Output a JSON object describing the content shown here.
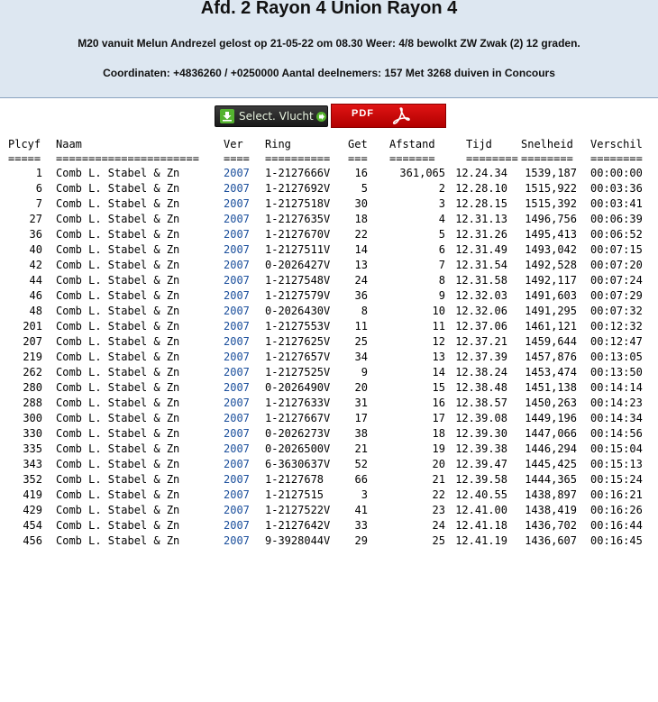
{
  "header": {
    "title": "Afd. 2 Rayon 4 Union Rayon 4",
    "subtitle": "M20 vanuit Melun Andrezel gelost op 21-05-22 om 08.30 Weer: 4/8 bewolkt ZW Zwak (2) 12 graden.",
    "coords": "Coordinaten: +4836260 / +0250000 Aantal deelnemers: 157 Met 3268 duiven in Concours"
  },
  "toolbar": {
    "select_label": "Select. Vlucht",
    "pdf_label": "PDF"
  },
  "colors": {
    "header_bg": "#dde7f1",
    "year_link": "#1b4f9c",
    "pdf_red": "#d40a0a",
    "select_bg": "#2a2a2a"
  },
  "table": {
    "columns": {
      "plcyf": "Plcyf",
      "naam": "Naam",
      "ver": "Ver",
      "ring": "Ring",
      "get": "Get",
      "afstand": "Afstand",
      "tijd": "Tijd",
      "snelheid": "Snelheid",
      "verschil": "Verschil"
    },
    "separators": {
      "plcyf": "=====",
      "naam": "======================",
      "ver": "====",
      "ring": "==========",
      "get": "===",
      "afstand": "=======",
      "tijd": "========",
      "snelheid": "========",
      "verschil": "========"
    },
    "rows": [
      {
        "plcyf": "1",
        "naam": "Comb L. Stabel & Zn",
        "ver": "2007",
        "ring": "1-2127666V",
        "get": "16",
        "afstand": "361,065",
        "tijd": "12.24.34",
        "snelheid": "1539,187",
        "verschil": "00:00:00"
      },
      {
        "plcyf": "6",
        "naam": "Comb L. Stabel & Zn",
        "ver": "2007",
        "ring": "1-2127692V",
        "get": "5",
        "afstand": "2",
        "tijd": "12.28.10",
        "snelheid": "1515,922",
        "verschil": "00:03:36"
      },
      {
        "plcyf": "7",
        "naam": "Comb L. Stabel & Zn",
        "ver": "2007",
        "ring": "1-2127518V",
        "get": "30",
        "afstand": "3",
        "tijd": "12.28.15",
        "snelheid": "1515,392",
        "verschil": "00:03:41"
      },
      {
        "plcyf": "27",
        "naam": "Comb L. Stabel & Zn",
        "ver": "2007",
        "ring": "1-2127635V",
        "get": "18",
        "afstand": "4",
        "tijd": "12.31.13",
        "snelheid": "1496,756",
        "verschil": "00:06:39"
      },
      {
        "plcyf": "36",
        "naam": "Comb L. Stabel & Zn",
        "ver": "2007",
        "ring": "1-2127670V",
        "get": "22",
        "afstand": "5",
        "tijd": "12.31.26",
        "snelheid": "1495,413",
        "verschil": "00:06:52"
      },
      {
        "plcyf": "40",
        "naam": "Comb L. Stabel & Zn",
        "ver": "2007",
        "ring": "1-2127511V",
        "get": "14",
        "afstand": "6",
        "tijd": "12.31.49",
        "snelheid": "1493,042",
        "verschil": "00:07:15"
      },
      {
        "plcyf": "42",
        "naam": "Comb L. Stabel & Zn",
        "ver": "2007",
        "ring": "0-2026427V",
        "get": "13",
        "afstand": "7",
        "tijd": "12.31.54",
        "snelheid": "1492,528",
        "verschil": "00:07:20"
      },
      {
        "plcyf": "44",
        "naam": "Comb L. Stabel & Zn",
        "ver": "2007",
        "ring": "1-2127548V",
        "get": "24",
        "afstand": "8",
        "tijd": "12.31.58",
        "snelheid": "1492,117",
        "verschil": "00:07:24"
      },
      {
        "plcyf": "46",
        "naam": "Comb L. Stabel & Zn",
        "ver": "2007",
        "ring": "1-2127579V",
        "get": "36",
        "afstand": "9",
        "tijd": "12.32.03",
        "snelheid": "1491,603",
        "verschil": "00:07:29"
      },
      {
        "plcyf": "48",
        "naam": "Comb L. Stabel & Zn",
        "ver": "2007",
        "ring": "0-2026430V",
        "get": "8",
        "afstand": "10",
        "tijd": "12.32.06",
        "snelheid": "1491,295",
        "verschil": "00:07:32"
      },
      {
        "plcyf": "201",
        "naam": "Comb L. Stabel & Zn",
        "ver": "2007",
        "ring": "1-2127553V",
        "get": "11",
        "afstand": "11",
        "tijd": "12.37.06",
        "snelheid": "1461,121",
        "verschil": "00:12:32"
      },
      {
        "plcyf": "207",
        "naam": "Comb L. Stabel & Zn",
        "ver": "2007",
        "ring": "1-2127625V",
        "get": "25",
        "afstand": "12",
        "tijd": "12.37.21",
        "snelheid": "1459,644",
        "verschil": "00:12:47"
      },
      {
        "plcyf": "219",
        "naam": "Comb L. Stabel & Zn",
        "ver": "2007",
        "ring": "1-2127657V",
        "get": "34",
        "afstand": "13",
        "tijd": "12.37.39",
        "snelheid": "1457,876",
        "verschil": "00:13:05"
      },
      {
        "plcyf": "262",
        "naam": "Comb L. Stabel & Zn",
        "ver": "2007",
        "ring": "1-2127525V",
        "get": "9",
        "afstand": "14",
        "tijd": "12.38.24",
        "snelheid": "1453,474",
        "verschil": "00:13:50"
      },
      {
        "plcyf": "280",
        "naam": "Comb L. Stabel & Zn",
        "ver": "2007",
        "ring": "0-2026490V",
        "get": "20",
        "afstand": "15",
        "tijd": "12.38.48",
        "snelheid": "1451,138",
        "verschil": "00:14:14"
      },
      {
        "plcyf": "288",
        "naam": "Comb L. Stabel & Zn",
        "ver": "2007",
        "ring": "1-2127633V",
        "get": "31",
        "afstand": "16",
        "tijd": "12.38.57",
        "snelheid": "1450,263",
        "verschil": "00:14:23"
      },
      {
        "plcyf": "300",
        "naam": "Comb L. Stabel & Zn",
        "ver": "2007",
        "ring": "1-2127667V",
        "get": "17",
        "afstand": "17",
        "tijd": "12.39.08",
        "snelheid": "1449,196",
        "verschil": "00:14:34"
      },
      {
        "plcyf": "330",
        "naam": "Comb L. Stabel & Zn",
        "ver": "2007",
        "ring": "0-2026273V",
        "get": "38",
        "afstand": "18",
        "tijd": "12.39.30",
        "snelheid": "1447,066",
        "verschil": "00:14:56"
      },
      {
        "plcyf": "335",
        "naam": "Comb L. Stabel & Zn",
        "ver": "2007",
        "ring": "0-2026500V",
        "get": "21",
        "afstand": "19",
        "tijd": "12.39.38",
        "snelheid": "1446,294",
        "verschil": "00:15:04"
      },
      {
        "plcyf": "343",
        "naam": "Comb L. Stabel & Zn",
        "ver": "2007",
        "ring": "6-3630637V",
        "get": "52",
        "afstand": "20",
        "tijd": "12.39.47",
        "snelheid": "1445,425",
        "verschil": "00:15:13"
      },
      {
        "plcyf": "352",
        "naam": "Comb L. Stabel & Zn",
        "ver": "2007",
        "ring": "1-2127678",
        "get": "66",
        "afstand": "21",
        "tijd": "12.39.58",
        "snelheid": "1444,365",
        "verschil": "00:15:24"
      },
      {
        "plcyf": "419",
        "naam": "Comb L. Stabel & Zn",
        "ver": "2007",
        "ring": "1-2127515",
        "get": "3",
        "afstand": "22",
        "tijd": "12.40.55",
        "snelheid": "1438,897",
        "verschil": "00:16:21"
      },
      {
        "plcyf": "429",
        "naam": "Comb L. Stabel & Zn",
        "ver": "2007",
        "ring": "1-2127522V",
        "get": "41",
        "afstand": "23",
        "tijd": "12.41.00",
        "snelheid": "1438,419",
        "verschil": "00:16:26"
      },
      {
        "plcyf": "454",
        "naam": "Comb L. Stabel & Zn",
        "ver": "2007",
        "ring": "1-2127642V",
        "get": "33",
        "afstand": "24",
        "tijd": "12.41.18",
        "snelheid": "1436,702",
        "verschil": "00:16:44"
      },
      {
        "plcyf": "456",
        "naam": "Comb L. Stabel & Zn",
        "ver": "2007",
        "ring": "9-3928044V",
        "get": "29",
        "afstand": "25",
        "tijd": "12.41.19",
        "snelheid": "1436,607",
        "verschil": "00:16:45"
      }
    ]
  }
}
